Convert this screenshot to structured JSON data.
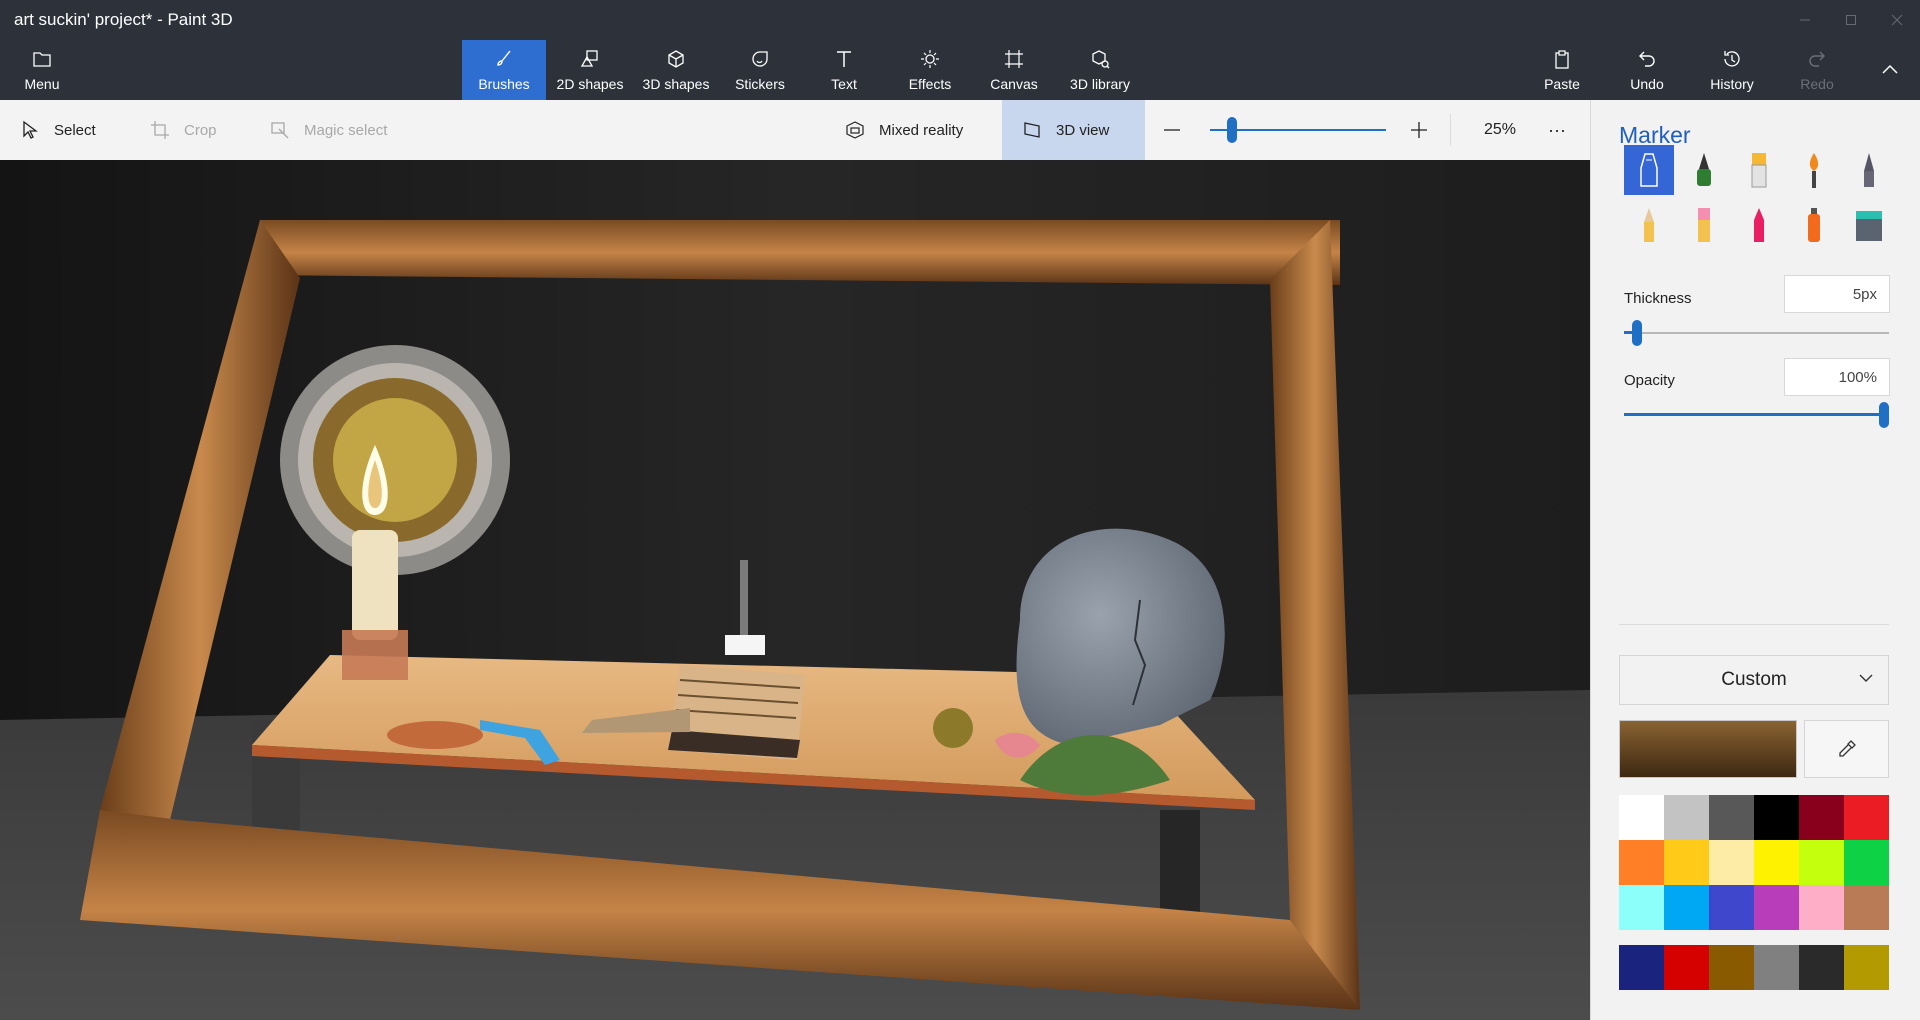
{
  "window": {
    "title": "art suckin' project* - Paint 3D"
  },
  "ribbon": {
    "menu": "Menu",
    "tools": [
      {
        "label": "Brushes",
        "icon": "brush-icon"
      },
      {
        "label": "2D shapes",
        "icon": "2d-shapes-icon"
      },
      {
        "label": "3D shapes",
        "icon": "cube-icon"
      },
      {
        "label": "Stickers",
        "icon": "sticker-icon"
      },
      {
        "label": "Text",
        "icon": "text-icon"
      },
      {
        "label": "Effects",
        "icon": "sun-icon"
      },
      {
        "label": "Canvas",
        "icon": "canvas-icon"
      },
      {
        "label": "3D library",
        "icon": "library-icon"
      }
    ],
    "paste": "Paste",
    "undo": "Undo",
    "history": "History",
    "redo": "Redo"
  },
  "toolbar": {
    "select": "Select",
    "crop": "Crop",
    "magic_select": "Magic select",
    "mixed_reality": "Mixed reality",
    "view_3d": "3D view",
    "zoom": "25%",
    "zoom_level": 0.1
  },
  "panel": {
    "title": "Marker",
    "thickness_label": "Thickness",
    "thickness_value": "5px",
    "thickness_level": 0.03,
    "opacity_label": "Opacity",
    "opacity_value": "100%",
    "opacity_level": 1.0,
    "color_mode": "Custom",
    "current_color": "#8a6331",
    "palette": [
      "#ffffff",
      "#c3c3c3",
      "#585858",
      "#000000",
      "#88001b",
      "#ec1c24",
      "#ff7f27",
      "#ffca18",
      "#fdeca6",
      "#fff200",
      "#c4ff0e",
      "#0ed145",
      "#8cfffb",
      "#00a8f3",
      "#3f48cc",
      "#b83dba",
      "#ffaec8",
      "#b97a56"
    ],
    "custom_palette": [
      "#1a237e",
      "#d50000",
      "#8a5a00",
      "#808080",
      "#2a2a2a",
      "#b39a00"
    ]
  }
}
